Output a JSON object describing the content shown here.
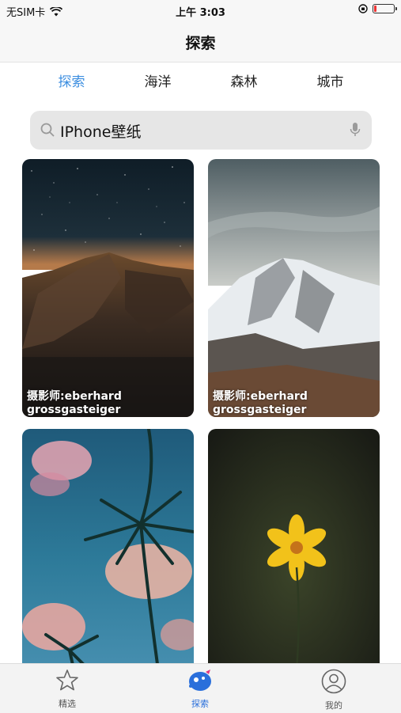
{
  "status_bar": {
    "carrier": "无SIM卡",
    "time": "上午 3:03"
  },
  "nav": {
    "title": "探索"
  },
  "tabs": [
    {
      "label": "探索",
      "active": true
    },
    {
      "label": "海洋",
      "active": false
    },
    {
      "label": "森林",
      "active": false
    },
    {
      "label": "城市",
      "active": false
    }
  ],
  "search": {
    "value": "IPhone壁纸"
  },
  "cards": [
    {
      "credit_line1": "摄影师:eberhard",
      "credit_line2": "grossgasteiger"
    },
    {
      "credit_line1": "摄影师:eberhard",
      "credit_line2": "grossgasteiger"
    },
    {
      "credit_line1": "",
      "credit_line2": ""
    },
    {
      "credit_line1": "",
      "credit_line2": ""
    }
  ],
  "tabbar": [
    {
      "label": "精选",
      "icon": "star-icon"
    },
    {
      "label": "探索",
      "icon": "explore-icon",
      "active": true
    },
    {
      "label": "我的",
      "icon": "profile-icon"
    }
  ],
  "colors": {
    "accent": "#3c8ee0",
    "active_tab_icon": "#2a6fdb"
  }
}
